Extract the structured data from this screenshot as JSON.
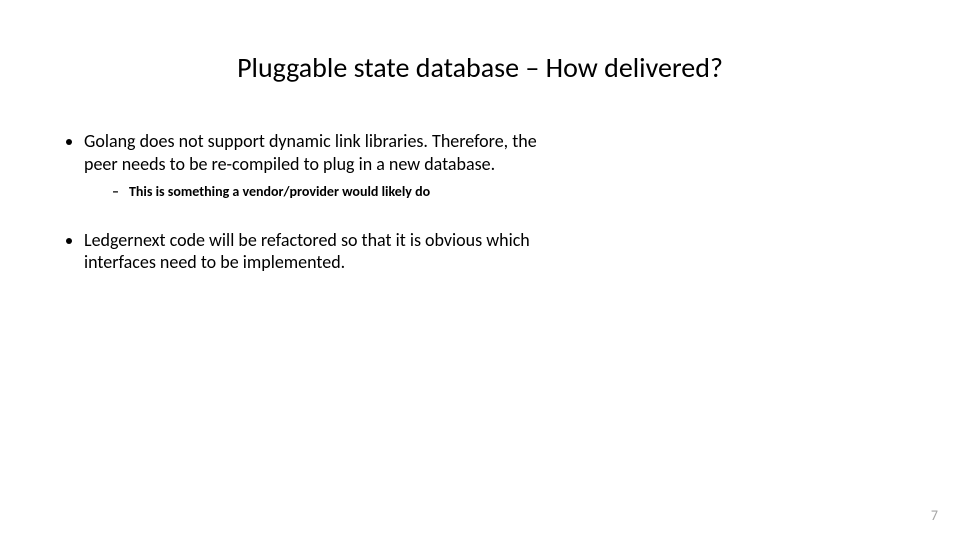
{
  "slide": {
    "title": "Pluggable state database – How delivered?",
    "bullets": [
      {
        "text": "Golang does not support dynamic link libraries. Therefore, the peer needs to be re-compiled to plug in a new database.",
        "sub": [
          "This is something a vendor/provider would likely do"
        ]
      },
      {
        "text": "Ledgernext code will be refactored so that it is obvious which interfaces need to be implemented.",
        "sub": []
      }
    ],
    "page_number": "7"
  }
}
